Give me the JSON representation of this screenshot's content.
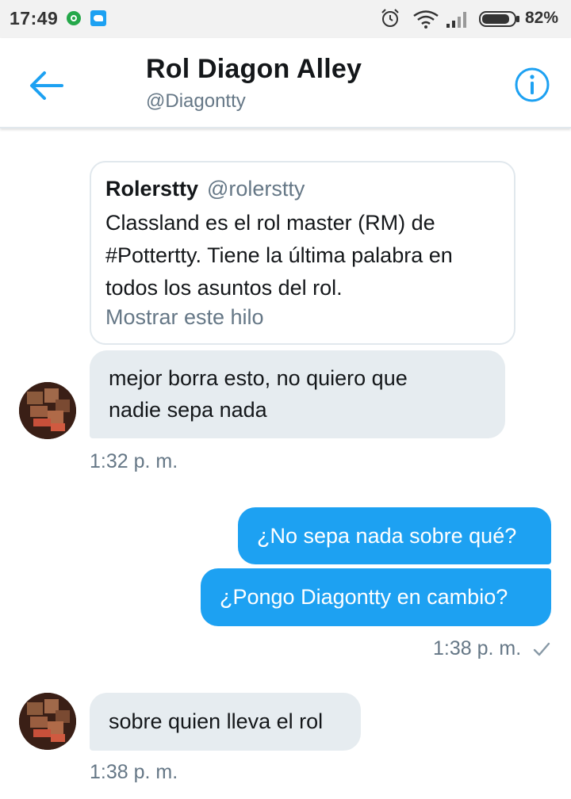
{
  "status_bar": {
    "time": "17:49",
    "battery_percent": "82%",
    "icons": [
      "whatsapp-icon",
      "twitter-icon",
      "alarm-icon",
      "wifi-icon",
      "signal-icon",
      "battery-icon"
    ]
  },
  "header": {
    "title": "Rol Diagon Alley",
    "handle": "@Diagontty",
    "back_icon": "arrow-left-icon",
    "info_icon": "info-icon"
  },
  "colors": {
    "accent": "#1da1f2",
    "incoming_bubble": "#e6ecf0",
    "secondary_text": "#657786"
  },
  "conversation": {
    "quoted_tweet": {
      "name": "Rolerstty",
      "handle": "@rolerstty",
      "text_lines": [
        "Classland es el rol master (RM) de",
        "#Pottertty. Tiene la última palabra en",
        "todos los asuntos del rol."
      ],
      "link": "Mostrar este hilo"
    },
    "messages": [
      {
        "direction": "in",
        "lines": [
          "mejor borra esto, no quiero que",
          "nadie sepa nada"
        ],
        "timestamp": "1:32 p. m."
      },
      {
        "direction": "out",
        "lines": [
          "¿No sepa nada sobre qué?"
        ]
      },
      {
        "direction": "out",
        "lines": [
          "¿Pongo Diagontty en cambio?"
        ],
        "timestamp": "1:38 p. m."
      },
      {
        "direction": "in",
        "lines": [
          "sobre quien lleva el rol"
        ],
        "timestamp": "1:38 p. m."
      }
    ]
  }
}
